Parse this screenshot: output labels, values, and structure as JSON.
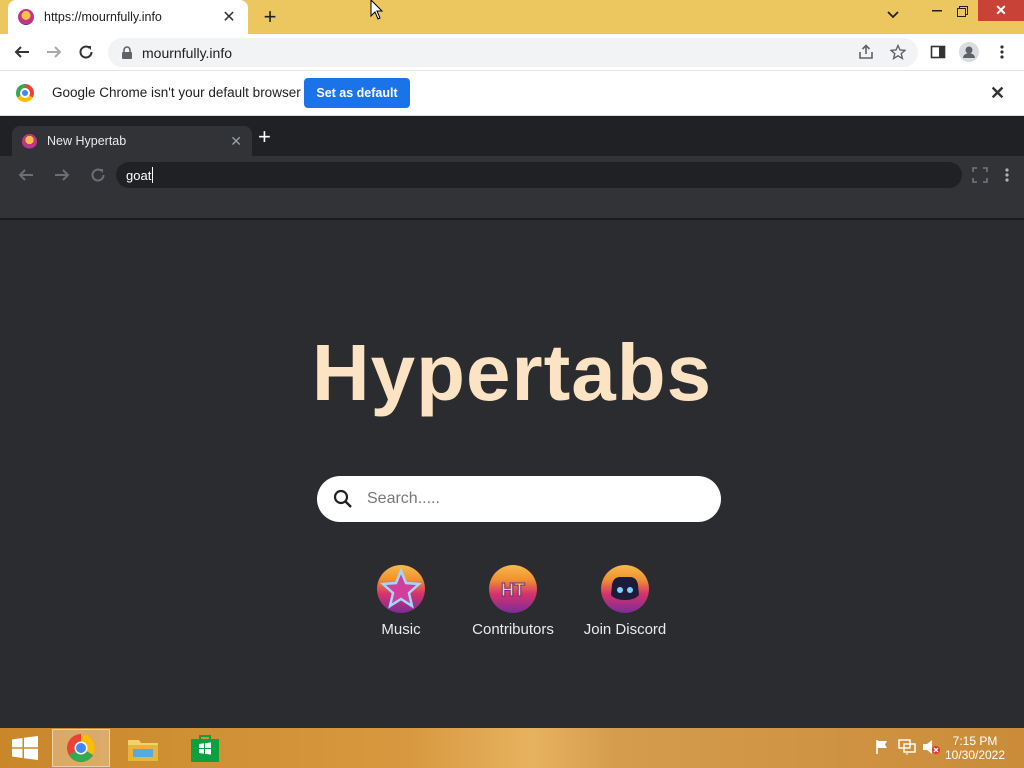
{
  "browser": {
    "tab_title": "https://mournfully.info",
    "url": "mournfully.info",
    "infobar_message": "Google Chrome isn't your default browser",
    "set_default_label": "Set as default"
  },
  "hypertabs": {
    "tab_title": "New Hypertab",
    "omnibox_value": "goat",
    "heading": "Hypertabs",
    "search_placeholder": "Search.....",
    "shortcuts": [
      {
        "label": "Music",
        "icon": "star-icon"
      },
      {
        "label": "Contributors",
        "icon": "ht-logo-icon"
      },
      {
        "label": "Join Discord",
        "icon": "discord-icon"
      }
    ]
  },
  "taskbar": {
    "time": "7:15 PM",
    "date": "10/30/2022"
  },
  "colors": {
    "titlebar": "#ecc760",
    "accent_blue": "#1a73e8",
    "heading": "#fbe3c4",
    "app_bg": "#2b2c30"
  }
}
